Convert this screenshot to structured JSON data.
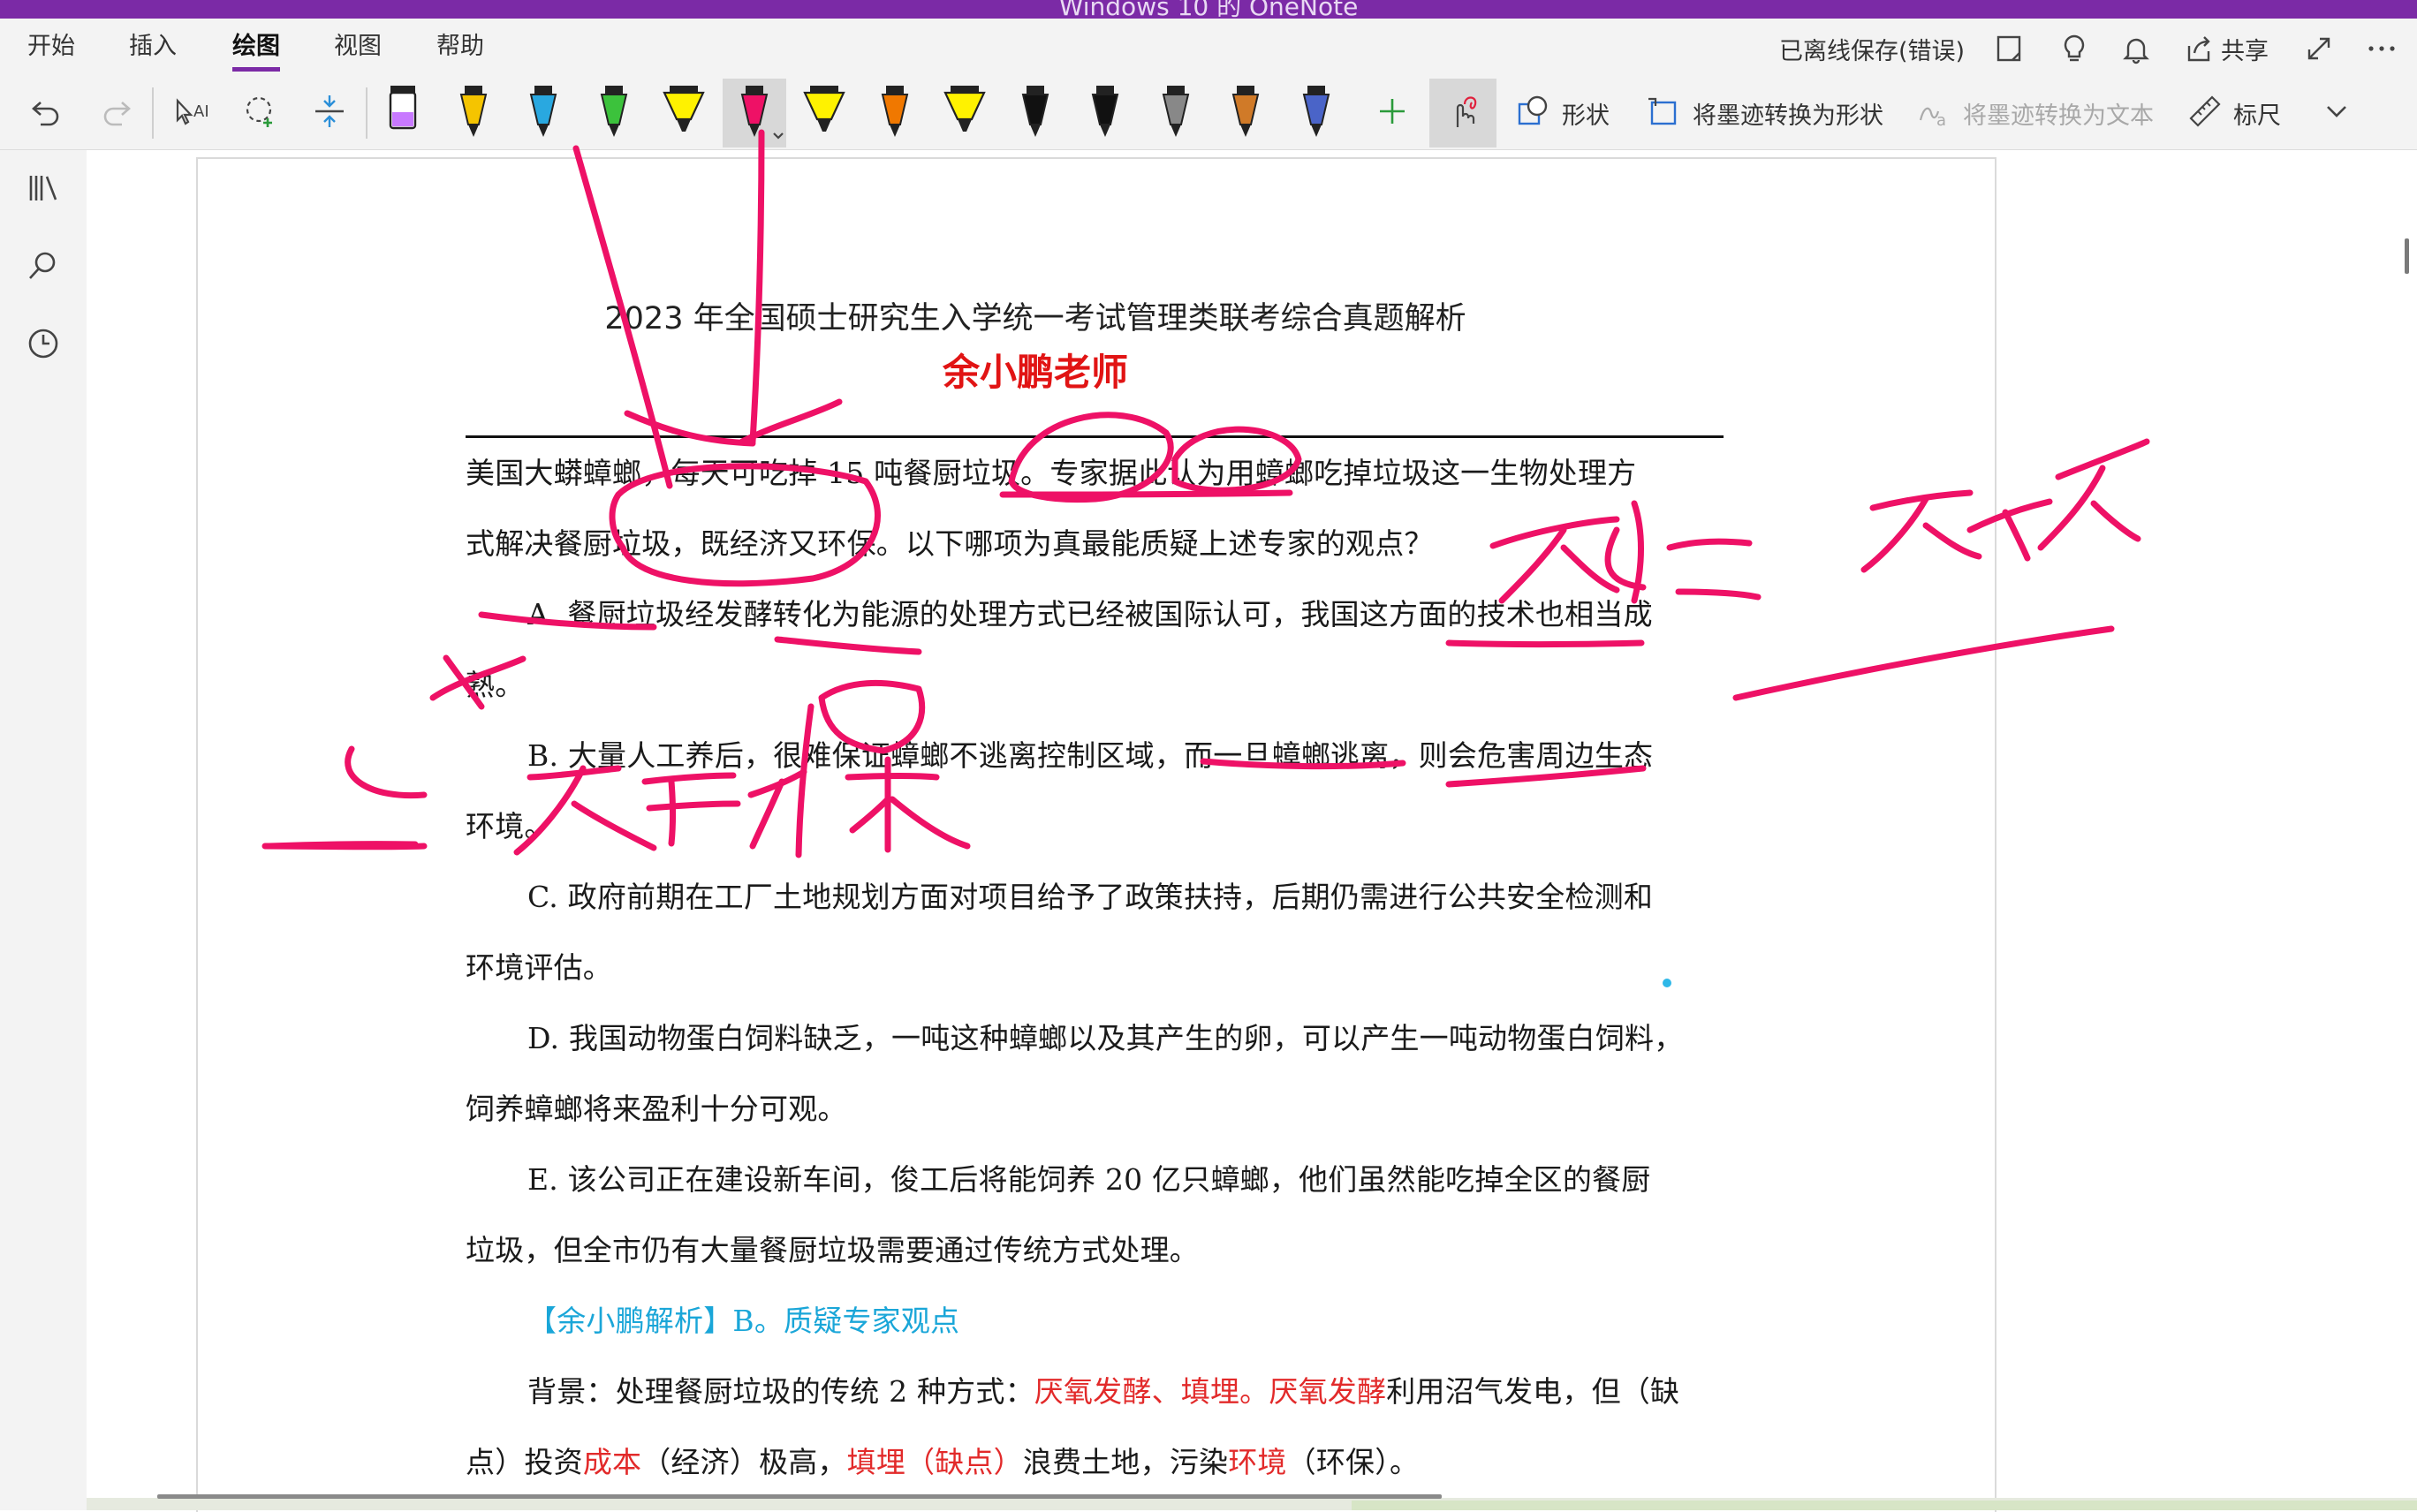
{
  "window": {
    "title": "Windows 10 的 OneNote"
  },
  "menu": {
    "tabs": [
      {
        "label": "开始"
      },
      {
        "label": "插入"
      },
      {
        "label": "绘图",
        "active": true
      },
      {
        "label": "视图"
      },
      {
        "label": "帮助"
      }
    ],
    "status": "已离线保存(错误)",
    "share_label": "共享",
    "icons": [
      "notes-icon",
      "lightbulb-icon",
      "bell-icon",
      "share-icon",
      "expand-icon",
      "more-icon"
    ]
  },
  "toolbar": {
    "pens": [
      {
        "color": "#c879ff",
        "type": "highlighter"
      },
      {
        "color": "#f5c400",
        "type": "pen"
      },
      {
        "color": "#29a8e0",
        "type": "pen"
      },
      {
        "color": "#3cc23c",
        "type": "pen"
      },
      {
        "color": "#fff200",
        "type": "highlighter"
      },
      {
        "color": "#ee1166",
        "type": "pen",
        "selected": true
      },
      {
        "color": "#fff200",
        "type": "highlighter"
      },
      {
        "color": "#f07800",
        "type": "pen"
      },
      {
        "color": "#fff200",
        "type": "highlighter"
      },
      {
        "color": "#111111",
        "type": "pen"
      },
      {
        "color": "#111111",
        "type": "pen"
      },
      {
        "color": "#888888",
        "type": "pen"
      },
      {
        "color": "#d07a28",
        "type": "pen"
      },
      {
        "color": "#4a64c8",
        "type": "pen"
      }
    ],
    "shape_label": "形状",
    "ink_to_shape_label": "将墨迹转换为形状",
    "ink_to_text_label": "将墨迹转换为文本",
    "ruler_label": "标尺"
  },
  "document": {
    "title": "2023 年全国硕士研究生入学统一考试管理类联考综合真题解析",
    "author": "余小鹏老师",
    "lines": [
      "美国大蟒蟑螂，每天可吃掉 15 吨餐厨垃圾。专家据此认为用蟑螂吃掉垃圾这一生物处理方",
      "式解决餐厨垃圾，既经济又环保。以下哪项为真最能质疑上述专家的观点？",
      "A. 餐厨垃圾经发酵转化为能源的处理方式已经被国际认可，我国这方面的技术也相当成",
      "熟。",
      "B. 大量人工养后，很难保证蟑螂不逃离控制区域，而一旦蟑螂逃离，则会危害周边生态",
      "环境。",
      "C. 政府前期在工厂土地规划方面对项目给予了政策扶持，后期仍需进行公共安全检测和",
      "环境评估。",
      "D. 我国动物蛋白饲料缺乏，一吨这种蟑螂以及其产生的卵，可以产生一吨动物蛋白饲料，",
      "饲养蟑螂将来盈利十分可观。",
      "E. 该公司正在建设新车间，俊工后将能饲养 20 亿只蟑螂，他们虽然能吃掉全区的餐厨",
      "垃圾，但全市仍有大量餐厨垃圾需要通过传统方式处理。"
    ],
    "analysis": "【余小鹏解析】B。质疑专家观点",
    "background": {
      "p1": "背景：处理餐厨垃圾的传统 2 种方式：",
      "r1": "厌氧发酵、填埋。厌氧发酵",
      "p2": "利用沼气发电，但（缺",
      "p3": "点）投资",
      "r2": "成本",
      "p4": "（经济）极高，",
      "r3": "填埋（缺点）",
      "p5": "浪费土地，污染",
      "r4": "环境",
      "p6": "（环保）。"
    }
  },
  "colors": {
    "accent": "#7b2aa6",
    "ink": "#ee1166",
    "analysis": "#1aa6d8",
    "emphasis": "#e22a2a"
  }
}
